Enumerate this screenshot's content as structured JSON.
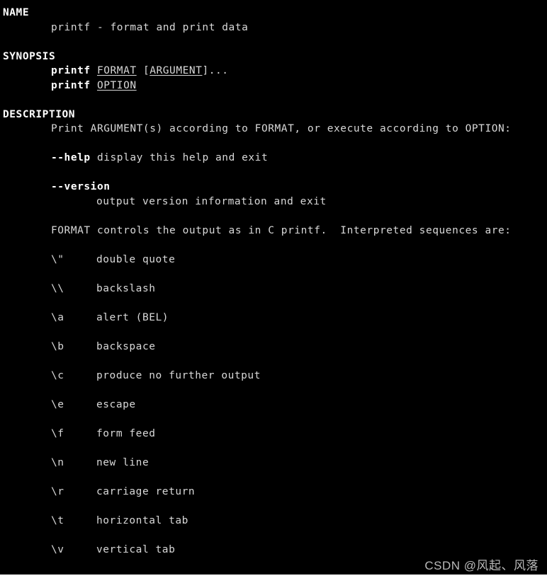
{
  "terminal": {
    "background": "#000000",
    "foreground": "#d8d8d8",
    "bold_color": "#ffffff"
  },
  "man_page": {
    "sections": [
      {
        "heading": "NAME",
        "lines": [
          {
            "indent": 1,
            "text": "printf - format and print data"
          }
        ]
      },
      {
        "heading": "SYNOPSIS",
        "lines": [
          {
            "indent": 1,
            "rich": true,
            "id": "synopsis_format"
          },
          {
            "indent": 1,
            "rich": true,
            "id": "synopsis_option"
          }
        ]
      },
      {
        "heading": "DESCRIPTION",
        "lines": [
          {
            "indent": 1,
            "text": "Print ARGUMENT(s) according to FORMAT, or execute according to OPTION:"
          }
        ]
      }
    ],
    "synopsis": {
      "command": "printf",
      "format_operand": "FORMAT",
      "argument_operand": "ARGUMENT",
      "argument_brackets_open": "[",
      "argument_brackets_close": "]",
      "ellipsis": "...",
      "option_operand": "OPTION"
    },
    "options": [
      {
        "flag": "--help",
        "inline_description": "display this help and exit",
        "block_description": ""
      },
      {
        "flag": "--version",
        "inline_description": "",
        "block_description": "output version information and exit"
      }
    ],
    "format_note": "FORMAT controls the output as in C printf.  Interpreted sequences are:",
    "escape_sequences": [
      {
        "code": "\\\"",
        "description": "double quote"
      },
      {
        "code": "\\\\",
        "description": "backslash"
      },
      {
        "code": "\\a",
        "description": "alert (BEL)"
      },
      {
        "code": "\\b",
        "description": "backspace"
      },
      {
        "code": "\\c",
        "description": "produce no further output"
      },
      {
        "code": "\\e",
        "description": "escape"
      },
      {
        "code": "\\f",
        "description": "form feed"
      },
      {
        "code": "\\n",
        "description": "new line"
      },
      {
        "code": "\\r",
        "description": "carriage return"
      },
      {
        "code": "\\t",
        "description": "horizontal tab"
      },
      {
        "code": "\\v",
        "description": "vertical tab"
      }
    ]
  },
  "watermark": {
    "text": "CSDN @风起、风落"
  }
}
